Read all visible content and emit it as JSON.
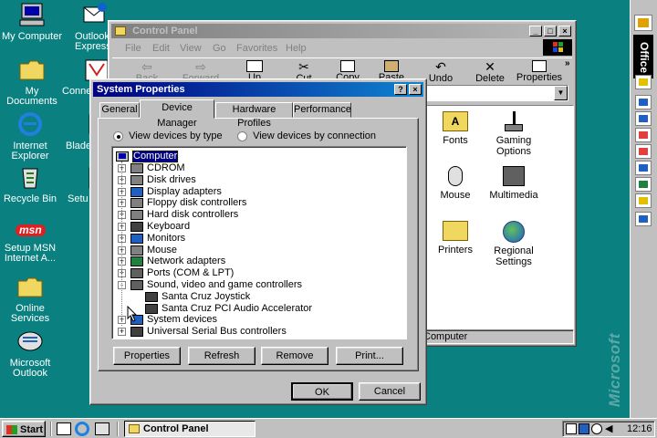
{
  "desktop": {
    "icons": [
      {
        "name": "my-computer",
        "label": "My Computer"
      },
      {
        "name": "outlook-express",
        "label": "Outlook Express"
      },
      {
        "name": "my-documents",
        "label": "My Documents"
      },
      {
        "name": "connect-internet",
        "label": "Connect Inte"
      },
      {
        "name": "internet-explorer",
        "label": "Internet Explorer"
      },
      {
        "name": "blade",
        "label": "Blade"
      },
      {
        "name": "recycle-bin",
        "label": "Recycle Bin"
      },
      {
        "name": "setup-microsoft",
        "label": "Setu Micro"
      },
      {
        "name": "setup-msn",
        "label": "Setup MSN Internet A..."
      },
      {
        "name": "online-services",
        "label": "Online Services"
      },
      {
        "name": "microsoft-outlook",
        "label": "Microsoft Outlook"
      }
    ],
    "msn_logo": "msn",
    "microsoft_watermark": "Microsoft"
  },
  "office_bar": {
    "title": "Office"
  },
  "control_panel": {
    "title": "Control Panel",
    "menu": [
      "File",
      "Edit",
      "View",
      "Go",
      "Favorites",
      "Help"
    ],
    "toolbar": [
      "Back",
      "Forward",
      "Up",
      "Cut",
      "Copy",
      "Paste",
      "Undo",
      "Delete",
      "Properties"
    ],
    "items": [
      {
        "name": "fonts",
        "label": "Fonts"
      },
      {
        "name": "gaming-options",
        "label": "Gaming Options"
      },
      {
        "name": "mouse",
        "label": "Mouse"
      },
      {
        "name": "multimedia",
        "label": "Multimedia"
      },
      {
        "name": "printers",
        "label": "Printers"
      },
      {
        "name": "regional-settings",
        "label": "Regional Settings"
      }
    ],
    "status": "Computer"
  },
  "system_properties": {
    "title": "System Properties",
    "help_btn": "?",
    "close_btn": "×",
    "tabs": [
      "General",
      "Device Manager",
      "Hardware Profiles",
      "Performance"
    ],
    "view_by_type": "View devices by type",
    "view_by_connection": "View devices by connection",
    "tree_root": "Computer",
    "tree": [
      {
        "label": "CDROM",
        "indent": 0,
        "expand": "+"
      },
      {
        "label": "Disk drives",
        "indent": 0,
        "expand": "+"
      },
      {
        "label": "Display adapters",
        "indent": 0,
        "expand": "+"
      },
      {
        "label": "Floppy disk controllers",
        "indent": 0,
        "expand": "+"
      },
      {
        "label": "Hard disk controllers",
        "indent": 0,
        "expand": "+"
      },
      {
        "label": "Keyboard",
        "indent": 0,
        "expand": "+"
      },
      {
        "label": "Monitors",
        "indent": 0,
        "expand": "+"
      },
      {
        "label": "Mouse",
        "indent": 0,
        "expand": "+"
      },
      {
        "label": "Network adapters",
        "indent": 0,
        "expand": "+"
      },
      {
        "label": "Ports (COM & LPT)",
        "indent": 0,
        "expand": "+"
      },
      {
        "label": "Sound, video and game controllers",
        "indent": 0,
        "expand": "-"
      },
      {
        "label": "Santa Cruz Joystick",
        "indent": 1,
        "expand": ""
      },
      {
        "label": "Santa Cruz PCI Audio Accelerator",
        "indent": 1,
        "expand": ""
      },
      {
        "label": "System devices",
        "indent": 0,
        "expand": "+"
      },
      {
        "label": "Universal Serial Bus controllers",
        "indent": 0,
        "expand": "+"
      }
    ],
    "buttons": {
      "properties": "Properties",
      "refresh": "Refresh",
      "remove": "Remove",
      "print": "Print...",
      "ok": "OK",
      "cancel": "Cancel"
    }
  },
  "taskbar": {
    "start": "Start",
    "task": "Control Panel",
    "clock": "12:16"
  }
}
